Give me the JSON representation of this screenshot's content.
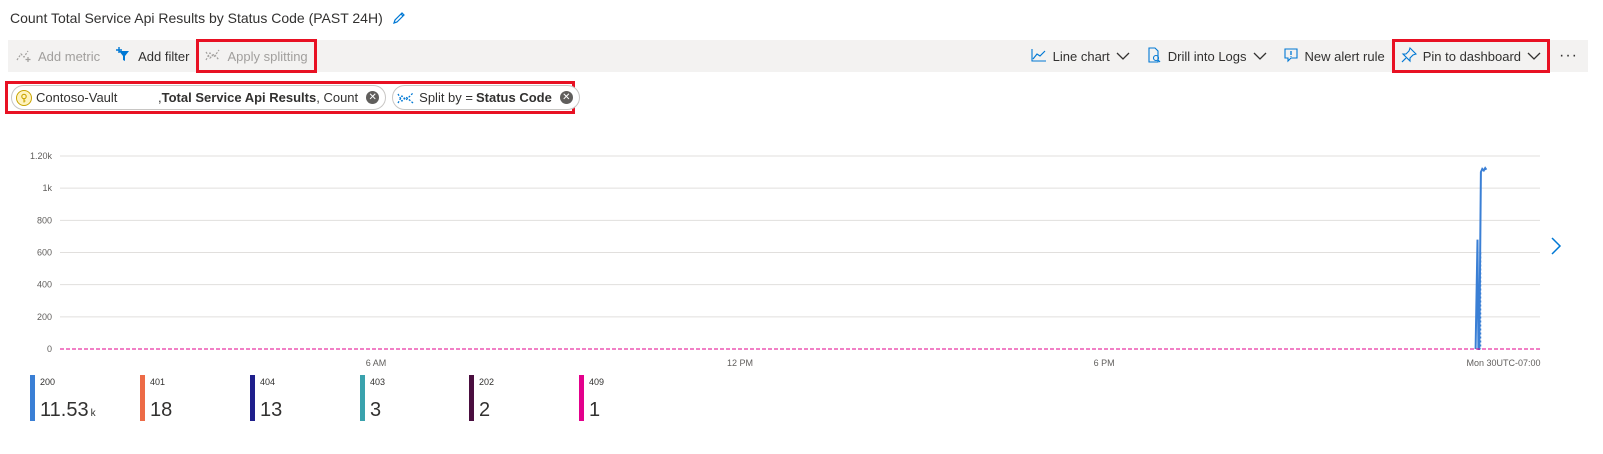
{
  "header": {
    "title": "Count Total Service Api Results by Status Code (PAST 24H)"
  },
  "toolbar": {
    "add_metric": "Add metric",
    "add_filter": "Add filter",
    "apply_splitting": "Apply splitting",
    "line_chart": "Line chart",
    "drill_into_logs": "Drill into Logs",
    "new_alert_rule": "New alert rule",
    "pin_to_dashboard": "Pin to dashboard",
    "more": "···"
  },
  "pills": {
    "resource": "Contoso-Vault",
    "metric_prefix": ",",
    "metric_bold": "Total Service Api Results",
    "metric_agg": ", Count",
    "split_label": "Split by =",
    "split_bold": "Status Code"
  },
  "colors": {
    "accent": "#0078d4",
    "highlight": "#e81123",
    "s200": "#3a7fd5",
    "s401": "#ed6b47",
    "s404": "#1f1f8c",
    "s403": "#3aa2ad",
    "s202": "#4a0e3f",
    "s409": "#e3008c"
  },
  "chart_data": {
    "type": "line",
    "y_ticks": [
      "0",
      "200",
      "400",
      "600",
      "800",
      "1k",
      "1.20k"
    ],
    "y_tick_values": [
      0,
      200,
      400,
      600,
      800,
      1000,
      1200
    ],
    "ylim": [
      0,
      1200
    ],
    "x_ticks": [
      "6 AM",
      "12 PM",
      "6 PM",
      "Mon 30",
      "UTC-07:00"
    ],
    "grid": true,
    "series": [
      {
        "name": "200",
        "color": "#3a7fd5",
        "points": [
          [
            0.9565,
            0
          ],
          [
            0.9578,
            680
          ],
          [
            0.9584,
            0
          ],
          [
            0.959,
            0
          ],
          [
            0.9601,
            1100
          ],
          [
            0.961,
            1120
          ],
          [
            0.962,
            1110
          ],
          [
            0.963,
            1125
          ],
          [
            0.9638,
            1115
          ]
        ]
      },
      {
        "name": "401",
        "color": "#ed6b47",
        "points": []
      },
      {
        "name": "409",
        "color": "#e3008c",
        "points": [
          [
            0.0,
            0
          ],
          [
            1.0,
            0
          ]
        ]
      }
    ]
  },
  "legend": [
    {
      "name": "200",
      "value": "11.53",
      "unit": "k",
      "color": "#3a7fd5"
    },
    {
      "name": "401",
      "value": "18",
      "unit": "",
      "color": "#ed6b47"
    },
    {
      "name": "404",
      "value": "13",
      "unit": "",
      "color": "#1f1f8c"
    },
    {
      "name": "403",
      "value": "3",
      "unit": "",
      "color": "#3aa2ad"
    },
    {
      "name": "202",
      "value": "2",
      "unit": "",
      "color": "#4a0e3f"
    },
    {
      "name": "409",
      "value": "1",
      "unit": "",
      "color": "#e3008c"
    }
  ]
}
